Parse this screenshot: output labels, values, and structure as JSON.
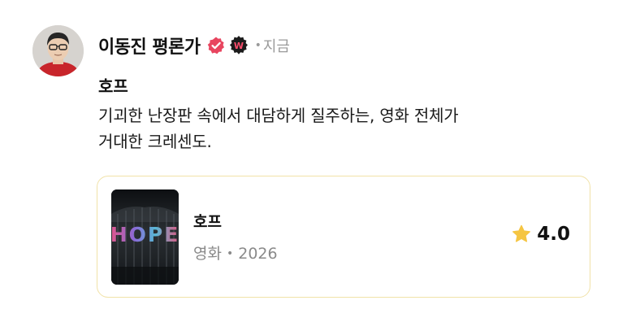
{
  "post": {
    "author": {
      "name": "이동진 평론가",
      "verified_icon": "verified-check-icon",
      "badge_icon": "w-badge-icon",
      "badge_letter": "W"
    },
    "separator": "•",
    "timestamp": "지금",
    "title": "호프",
    "body_lines": [
      "기괴한 난장판 속에서 대담하게 질주하는, 영화 전체가",
      "거대한 크레센도."
    ]
  },
  "movie_card": {
    "poster_text": "HOPE",
    "title": "호프",
    "category": "영화",
    "separator": "•",
    "year": "2026",
    "rating": "4.0",
    "star_icon": "star-icon"
  },
  "colors": {
    "verified": "#e8455f",
    "badge": "#1c1c1c",
    "badge_letter": "#ff4d6d",
    "star": "#f5c542",
    "card_border": "#f1e2a8",
    "muted_text": "#8a8a8a"
  }
}
